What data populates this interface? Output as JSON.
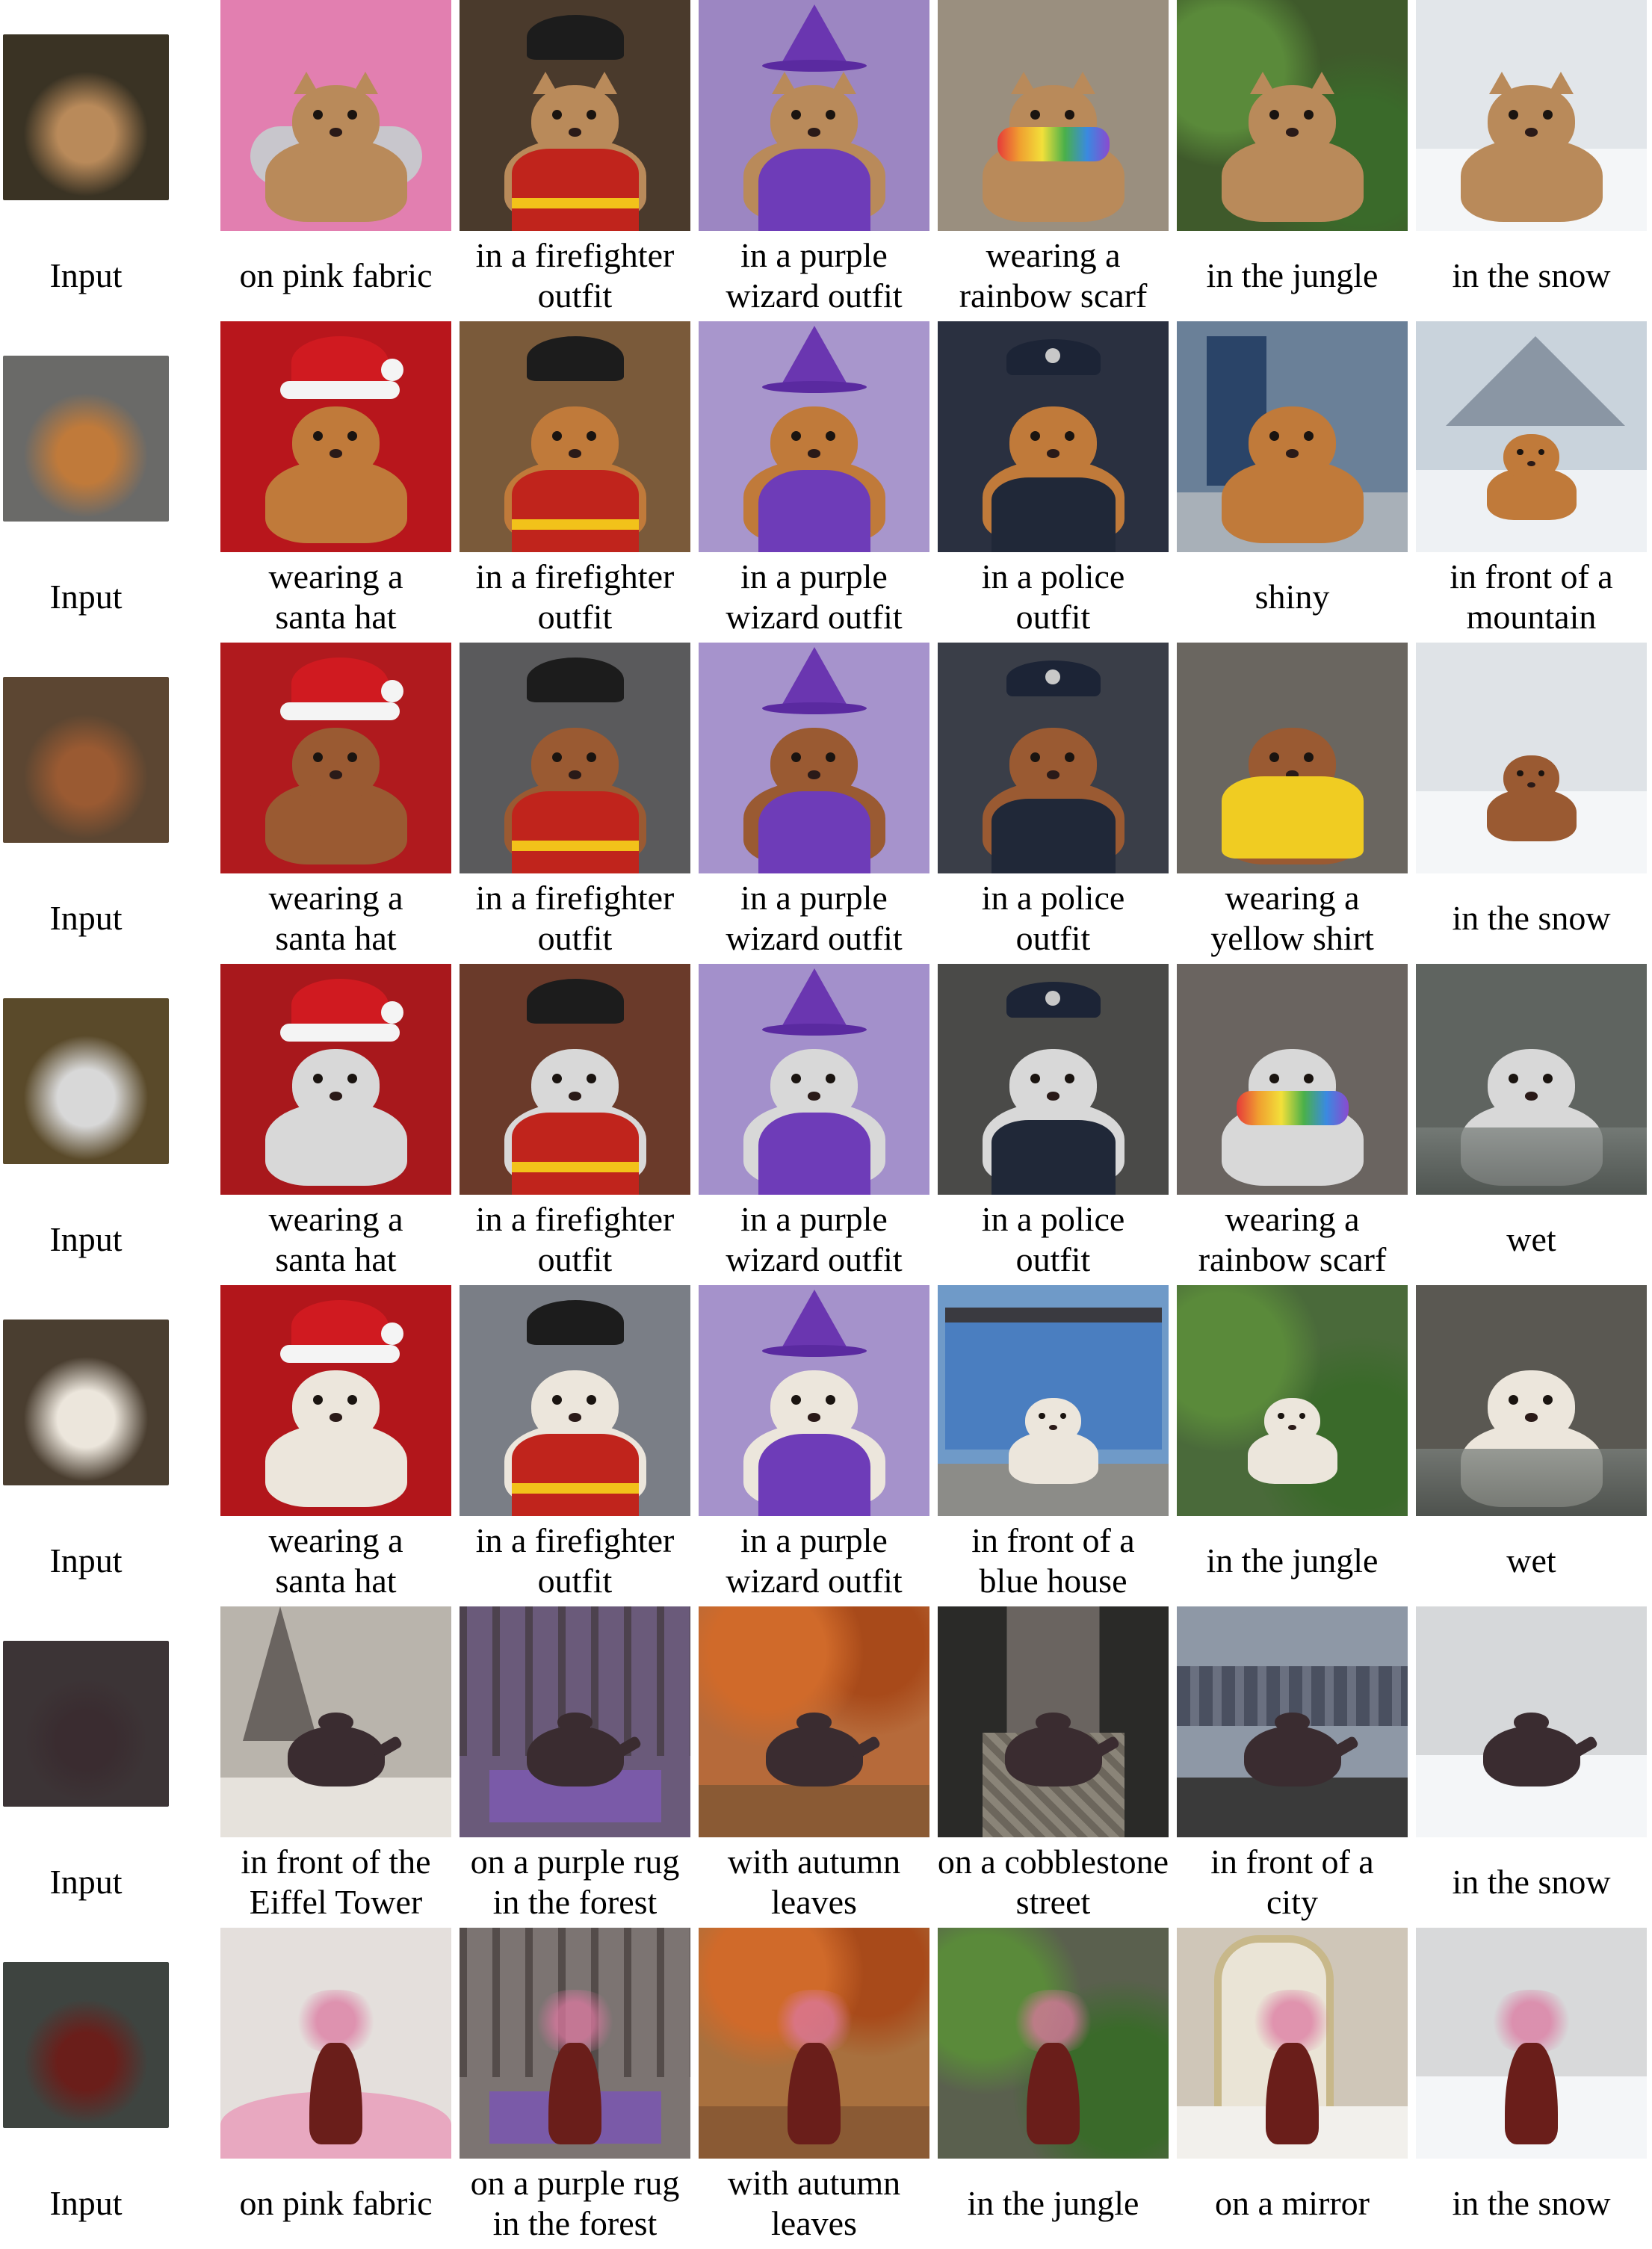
{
  "figure": {
    "rows": [
      {
        "input_label": "Input",
        "subject": "cat",
        "input_bg": "#3a3324",
        "subject_color": "#b98a5a",
        "cells": [
          {
            "caption_lines": [
              "on pink fabric"
            ],
            "bg": "#e27fb0",
            "accessory": "pink-cushion"
          },
          {
            "caption_lines": [
              "in a firefighter",
              "outfit"
            ],
            "bg": "#4a3a2c",
            "accessory": "firefighter-outfit"
          },
          {
            "caption_lines": [
              "in a purple",
              "wizard outfit"
            ],
            "bg": "#9c86c2",
            "accessory": "wizard-outfit"
          },
          {
            "caption_lines": [
              "wearing a",
              "rainbow scarf"
            ],
            "bg": "#9a8f7f",
            "accessory": "rainbow-scarf"
          },
          {
            "caption_lines": [
              "in the jungle"
            ],
            "bg": "#3f5a2b",
            "accessory": "jungle"
          },
          {
            "caption_lines": [
              "in the snow"
            ],
            "bg": "#e2e6ea",
            "accessory": "snow"
          }
        ]
      },
      {
        "input_label": "Input",
        "subject": "dog",
        "input_bg": "#6a6a68",
        "subject_color": "#c07a3a",
        "cells": [
          {
            "caption_lines": [
              "wearing a",
              "santa hat"
            ],
            "bg": "#b8161c",
            "accessory": "santa-hat"
          },
          {
            "caption_lines": [
              "in a firefighter",
              "outfit"
            ],
            "bg": "#7a5a3a",
            "accessory": "firefighter-outfit"
          },
          {
            "caption_lines": [
              "in a purple",
              "wizard outfit"
            ],
            "bg": "#a896cc",
            "accessory": "wizard-outfit"
          },
          {
            "caption_lines": [
              "in a police",
              "outfit"
            ],
            "bg": "#2a3040",
            "accessory": "police-outfit"
          },
          {
            "caption_lines": [
              "shiny"
            ],
            "bg": "#6a8098",
            "accessory": "shiny"
          },
          {
            "caption_lines": [
              "in front of a",
              "mountain"
            ],
            "bg": "#c9d3dc",
            "accessory": "mountain"
          }
        ]
      },
      {
        "input_label": "Input",
        "subject": "dog",
        "input_bg": "#5c4632",
        "subject_color": "#9a5a32",
        "cells": [
          {
            "caption_lines": [
              "wearing a",
              "santa hat"
            ],
            "bg": "#b01a1e",
            "accessory": "santa-hat"
          },
          {
            "caption_lines": [
              "in a firefighter",
              "outfit"
            ],
            "bg": "#5a5a5c",
            "accessory": "firefighter-outfit"
          },
          {
            "caption_lines": [
              "in a purple",
              "wizard outfit"
            ],
            "bg": "#a693cc",
            "accessory": "wizard-outfit"
          },
          {
            "caption_lines": [
              "in a police",
              "outfit"
            ],
            "bg": "#3a3e48",
            "accessory": "police-outfit"
          },
          {
            "caption_lines": [
              "wearing a",
              "yellow shirt"
            ],
            "bg": "#6a6660",
            "accessory": "yellow-shirt"
          },
          {
            "caption_lines": [
              "in the snow"
            ],
            "bg": "#dfe3e7",
            "accessory": "snow"
          }
        ]
      },
      {
        "input_label": "Input",
        "subject": "dog",
        "input_bg": "#5a4a2a",
        "subject_color": "#d8d8d8",
        "cells": [
          {
            "caption_lines": [
              "wearing a",
              "santa hat"
            ],
            "bg": "#a8181c",
            "accessory": "santa-hat"
          },
          {
            "caption_lines": [
              "in a firefighter",
              "outfit"
            ],
            "bg": "#6a3a2a",
            "accessory": "firefighter-outfit"
          },
          {
            "caption_lines": [
              "in a purple",
              "wizard outfit"
            ],
            "bg": "#a390cb",
            "accessory": "wizard-outfit"
          },
          {
            "caption_lines": [
              "in a police",
              "outfit"
            ],
            "bg": "#4a4a48",
            "accessory": "police-outfit"
          },
          {
            "caption_lines": [
              "wearing a",
              "rainbow scarf"
            ],
            "bg": "#6a6460",
            "accessory": "rainbow-scarf"
          },
          {
            "caption_lines": [
              "wet"
            ],
            "bg": "#5f6460",
            "accessory": "wet"
          }
        ]
      },
      {
        "input_label": "Input",
        "subject": "dog",
        "input_bg": "#4a3e30",
        "subject_color": "#ece6dc",
        "cells": [
          {
            "caption_lines": [
              "wearing a",
              "santa hat"
            ],
            "bg": "#b2161b",
            "accessory": "santa-hat"
          },
          {
            "caption_lines": [
              "in a firefighter",
              "outfit"
            ],
            "bg": "#7a7e86",
            "accessory": "firefighter-outfit"
          },
          {
            "caption_lines": [
              "in a purple",
              "wizard outfit"
            ],
            "bg": "#a592cb",
            "accessory": "wizard-outfit"
          },
          {
            "caption_lines": [
              "in front of a",
              "blue house"
            ],
            "bg": "#6f9ac8",
            "accessory": "blue-house"
          },
          {
            "caption_lines": [
              "in the jungle"
            ],
            "bg": "#4a6a3a",
            "accessory": "jungle"
          },
          {
            "caption_lines": [
              "wet"
            ],
            "bg": "#5a5852",
            "accessory": "wet"
          }
        ]
      },
      {
        "input_label": "Input",
        "subject": "teapot",
        "input_bg": "#3c3436",
        "subject_color": "#3a2c30",
        "cells": [
          {
            "caption_lines": [
              "in front of the",
              "Eiffel Tower"
            ],
            "bg": "#b9b4ac",
            "accessory": "eiffel-tower"
          },
          {
            "caption_lines": [
              "on a purple rug",
              "in the forest"
            ],
            "bg": "#6a5a7a",
            "accessory": "purple-rug-forest"
          },
          {
            "caption_lines": [
              "with autumn",
              "leaves"
            ],
            "bg": "#b66a3a",
            "accessory": "autumn-leaves"
          },
          {
            "caption_lines": [
              "on a cobblestone",
              "street"
            ],
            "bg": "#4a4a46",
            "accessory": "cobblestone-street"
          },
          {
            "caption_lines": [
              "in front of a",
              "city"
            ],
            "bg": "#8e98a6",
            "accessory": "city"
          },
          {
            "caption_lines": [
              "in the snow"
            ],
            "bg": "#d6d8da",
            "accessory": "snow"
          }
        ]
      },
      {
        "input_label": "Input",
        "subject": "vase",
        "input_bg": "#3e4440",
        "subject_color": "#6a1e1a",
        "cells": [
          {
            "caption_lines": [
              "on pink fabric"
            ],
            "bg": "#e4dfdc",
            "accessory": "pink-fabric"
          },
          {
            "caption_lines": [
              "on a purple rug",
              "in the forest"
            ],
            "bg": "#7c7472",
            "accessory": "purple-rug-forest"
          },
          {
            "caption_lines": [
              "with autumn",
              "leaves"
            ],
            "bg": "#a8703e",
            "accessory": "autumn-leaves"
          },
          {
            "caption_lines": [
              "in the jungle"
            ],
            "bg": "#5a604e",
            "accessory": "jungle"
          },
          {
            "caption_lines": [
              "on a mirror"
            ],
            "bg": "#cfc6b8",
            "accessory": "mirror"
          },
          {
            "caption_lines": [
              "in the snow"
            ],
            "bg": "#d8d9da",
            "accessory": "snow"
          }
        ]
      }
    ]
  }
}
